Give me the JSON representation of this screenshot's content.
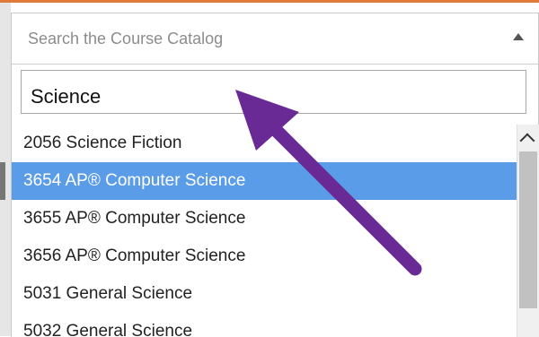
{
  "select": {
    "placeholder": "Search the Course Catalog"
  },
  "search": {
    "value": "Science"
  },
  "results": [
    {
      "label": "2056 Science Fiction",
      "highlighted": false
    },
    {
      "label": "3654 AP® Computer Science",
      "highlighted": true
    },
    {
      "label": "3655 AP® Computer Science",
      "highlighted": false
    },
    {
      "label": "3656 AP® Computer Science",
      "highlighted": false
    },
    {
      "label": "5031 General Science",
      "highlighted": false
    },
    {
      "label": "5032 General Science",
      "highlighted": false
    }
  ],
  "colors": {
    "highlight": "#5b9ce8",
    "annotation_arrow": "#6a2a96",
    "top_accent": "#e07a3a"
  },
  "icons": {
    "select_caret": "caret-up-icon",
    "scroll_up": "chevron-up-icon",
    "annotation": "arrow-annotation-icon"
  }
}
